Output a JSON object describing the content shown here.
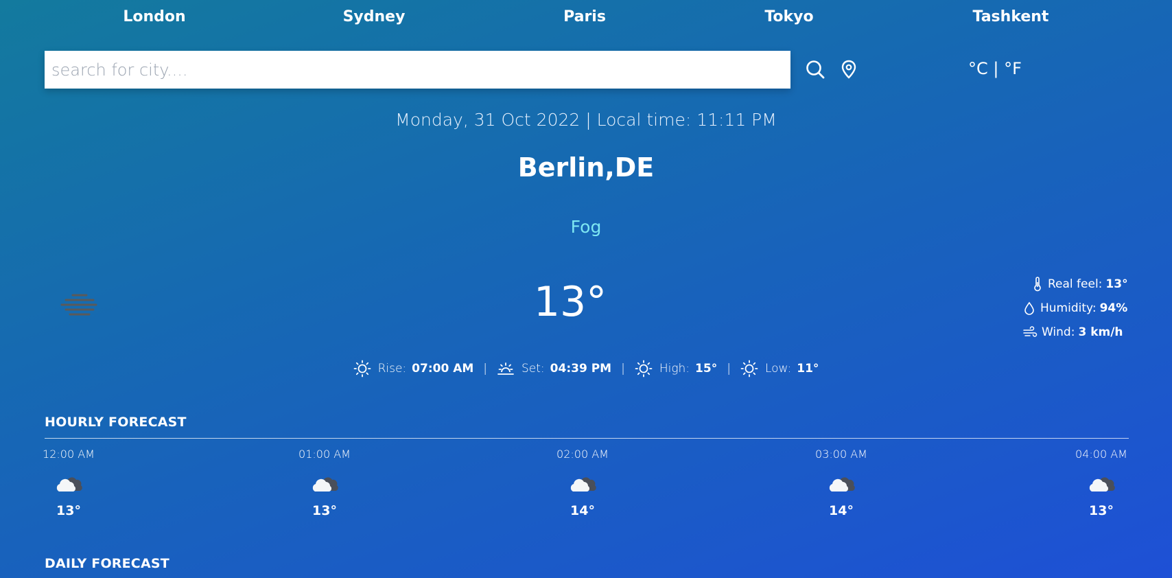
{
  "nav": {
    "cities": [
      "London",
      "Sydney",
      "Paris",
      "Tokyo",
      "Tashkent"
    ]
  },
  "search": {
    "placeholder": "search for city....",
    "value": ""
  },
  "icons": {
    "search": "search-icon",
    "location": "location-pin-icon",
    "thermometer": "thermometer-icon",
    "humidity": "droplet-icon",
    "wind": "wind-icon",
    "sun": "sun-icon",
    "sunset": "sunset-icon",
    "fog": "fog-icon",
    "cloud": "cloud-icon"
  },
  "units": {
    "celsius": "°C",
    "separator": "|",
    "fahrenheit": "°F"
  },
  "current": {
    "date_line": "Monday, 31 Oct 2022 | Local time: 11:11 PM",
    "location": "Berlin,DE",
    "condition": "Fog",
    "temperature": "13°",
    "details": {
      "real_feel_label": "Real feel:",
      "real_feel": "13°",
      "humidity_label": "Humidity:",
      "humidity": "94%",
      "wind_label": "Wind:",
      "wind": "3 km/h"
    },
    "sun": {
      "rise_label": "Rise:",
      "rise": "07:00 AM",
      "set_label": "Set:",
      "set": "04:39 PM",
      "high_label": "High:",
      "high": "15°",
      "low_label": "Low:",
      "low": "11°",
      "separator": "|"
    }
  },
  "hourly": {
    "title": "HOURLY FORECAST",
    "items": [
      {
        "time": "12:00 AM",
        "temp": "13°"
      },
      {
        "time": "01:00 AM",
        "temp": "13°"
      },
      {
        "time": "02:00 AM",
        "temp": "14°"
      },
      {
        "time": "03:00 AM",
        "temp": "14°"
      },
      {
        "time": "04:00 AM",
        "temp": "13°"
      }
    ]
  },
  "daily": {
    "title": "DAILY FORECAST"
  },
  "colors": {
    "background_start": "#137a9e",
    "background_end": "#1e50d6",
    "condition_text": "#7ee7f2"
  }
}
